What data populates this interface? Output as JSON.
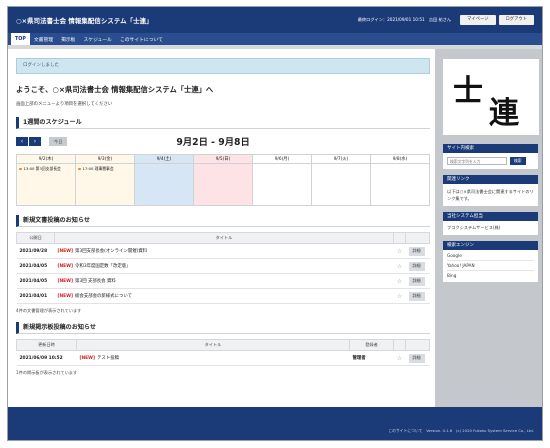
{
  "header": {
    "app_title": "○×県司法書士会 情報集配信システム「士連」",
    "login_info": "最終ログイン：2021/09/01 10:51　吉田 祐さん",
    "mypage_label": "マイページ",
    "logout_label": "ログアウト"
  },
  "nav": {
    "items": [
      "TOP",
      "文書管理",
      "掲示板",
      "スケジュール",
      "このサイトについて"
    ]
  },
  "alert": {
    "message": "ログインしました"
  },
  "welcome": {
    "title": "ようこそ、○×県司法書士会 情報集配信システム「士連」へ",
    "subtitle": "画面上部のメニューより項目を選択してください"
  },
  "schedule": {
    "heading": "1週間のスケジュール",
    "prev_icon": "chevron-left-icon",
    "next_icon": "chevron-right-icon",
    "today_label": "今日",
    "range": "9月2日 - 9月8日",
    "days": [
      {
        "label": "9/2(木)",
        "type": "hl",
        "event": "13:00 第3回支部長会"
      },
      {
        "label": "9/3(金)",
        "type": "hl",
        "event": "17:00 理事懇事会"
      },
      {
        "label": "9/4(土)",
        "type": "sat",
        "event": ""
      },
      {
        "label": "9/5(日)",
        "type": "sun",
        "event": ""
      },
      {
        "label": "9/6(月)",
        "type": "weekday",
        "event": ""
      },
      {
        "label": "9/7(火)",
        "type": "weekday",
        "event": ""
      },
      {
        "label": "9/8(水)",
        "type": "weekday",
        "event": ""
      }
    ]
  },
  "documents": {
    "heading": "新規文書投稿のお知らせ",
    "columns": {
      "date": "公開日",
      "title": "タイトル"
    },
    "new_tag": "[NEW]",
    "detail_label": "詳細",
    "rows": [
      {
        "date": "2021/09/28",
        "title": "第3回支部長会(オンライン開催)資料"
      },
      {
        "date": "2021/04/05",
        "title": "令和3年度国定数「改定版」"
      },
      {
        "date": "2021/04/05",
        "title": "第3回 支部長会 資料"
      },
      {
        "date": "2021/04/01",
        "title": "総会支部会の新様式について"
      }
    ],
    "footer_note": "4件の文書管理が表示されています"
  },
  "board": {
    "heading": "新規掲示板投稿のお知らせ",
    "columns": {
      "datetime": "更新日時",
      "title": "タイトル",
      "poster": "登録者"
    },
    "new_tag": "[NEW]",
    "detail_label": "詳細",
    "rows": [
      {
        "datetime": "2021/06/09 10:52",
        "title": "テスト投稿",
        "poster": "管理者"
      }
    ],
    "footer_note": "1件の掲示板が表示されています"
  },
  "sidebar": {
    "logo_text": "士連",
    "site_search": {
      "title": "サイト内検索",
      "placeholder": "検索文字列を入力",
      "button": "検索"
    },
    "related": {
      "title": "関連リンク",
      "text": "以下は○×県司法書士会に関連するサイトのリンク集です。"
    },
    "system": {
      "title": "当社システム担当",
      "link": "フコクシステムサービス(株)"
    },
    "engines": {
      "title": "検索エンジン",
      "items": [
        "Google",
        "Yahoo! JAPAN",
        "Bing"
      ]
    }
  },
  "footer": {
    "text": "このサイトについて　Version. 0.1.6　(c) 2020 Fukoku System Service Co., Ltd."
  }
}
